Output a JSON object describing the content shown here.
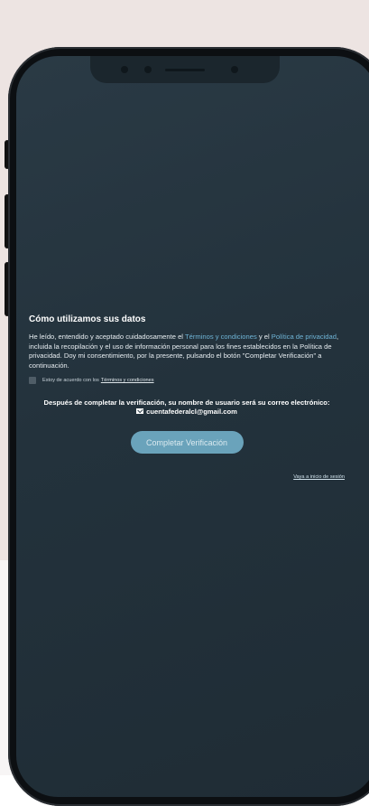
{
  "section_title": "Cómo utilizamos sus datos",
  "paragraph": {
    "part1": "He leído, entendido y aceptado cuidadosamente el ",
    "terms_link": "Términos y condiciones",
    "part2": " y el ",
    "privacy_link": "Política de privacidad",
    "part3": ", incluida la recopilación y el uso de información personal para los fines establecidos en la Política de privacidad. Doy mi consentimiento, por la presente, pulsando el botón \"Completar Verificación\" a continuación."
  },
  "agreement": {
    "checked": false,
    "label": "Estoy de acuerdo con los",
    "link": "Términos y condiciones"
  },
  "after_verification_text": "Después de completar la verificación, su nombre de usuario será su correo electrónico:",
  "email": "cuentafederalcl@gmail.com",
  "email_icon": "envelope-icon",
  "complete_button_label": "Completar Verificación",
  "login_link": "Vaya a inicio de sesión",
  "colors": {
    "screen_bg": "#23323c",
    "link": "#6fb4d6",
    "button": "#6aa3bb",
    "page_bg": "#ede4e2"
  }
}
